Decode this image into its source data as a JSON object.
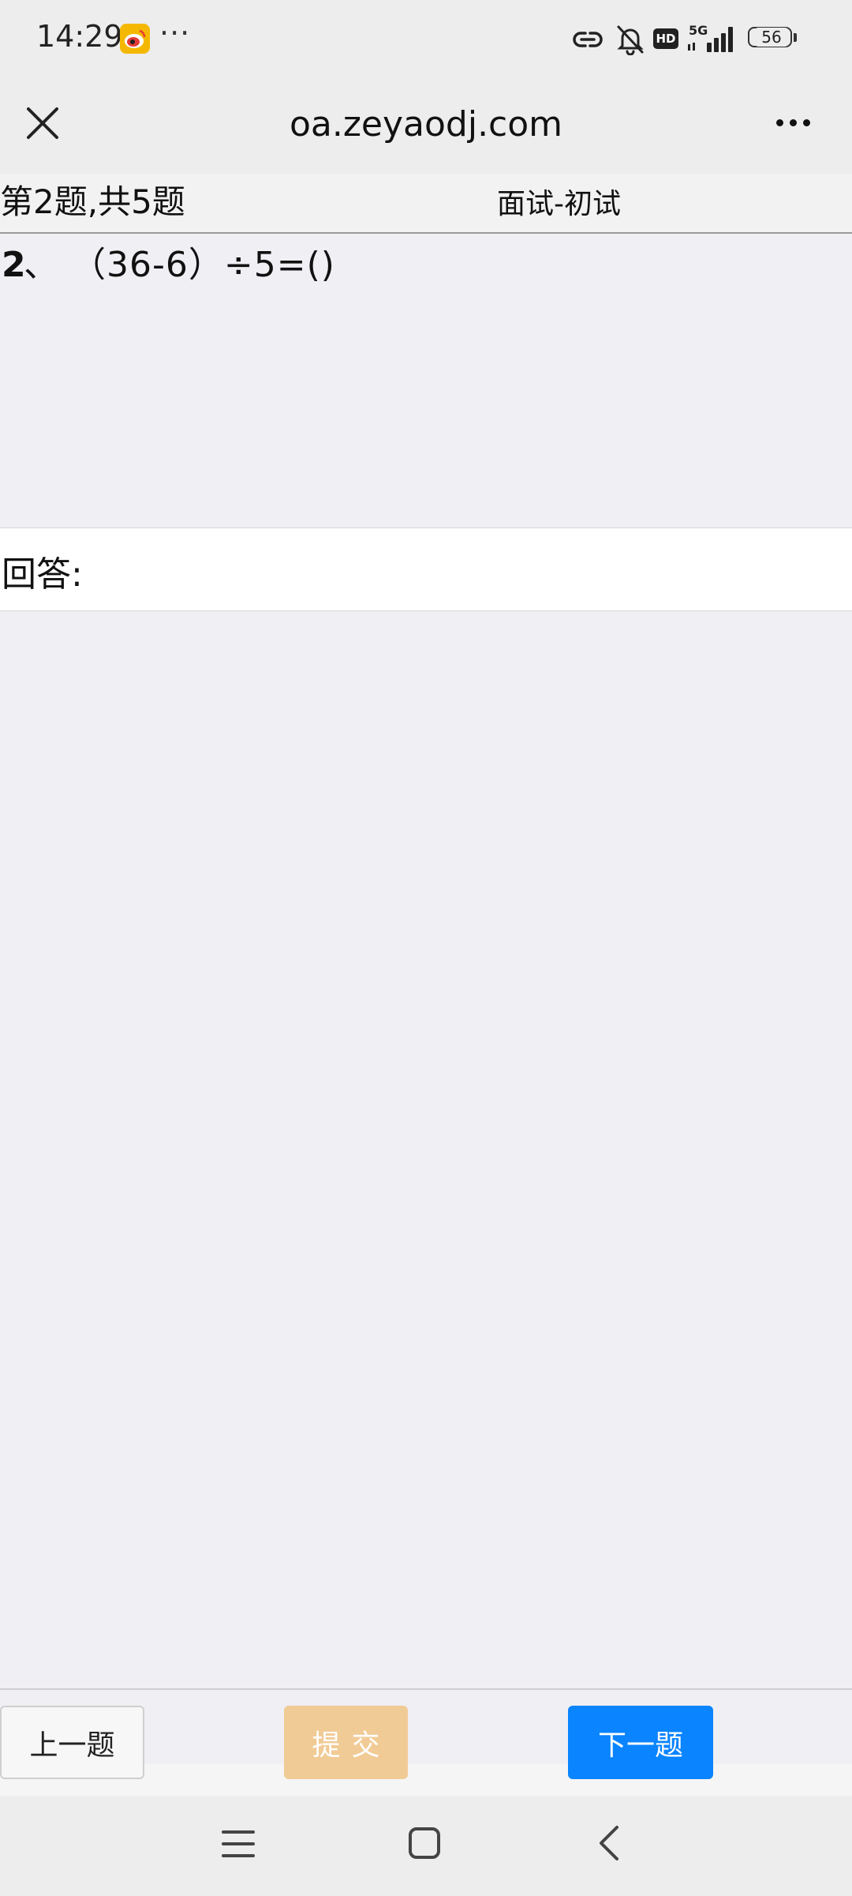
{
  "status_bar": {
    "time": "14:29",
    "more": "···",
    "network": "5G",
    "hd": "HD",
    "battery_level": "56",
    "icons": [
      "weibo-icon",
      "link-icon",
      "bell-muted-icon",
      "signal-icon",
      "battery-icon"
    ]
  },
  "browser": {
    "url_title": "oa.zeyaodj.com",
    "close_icon": "close-icon",
    "menu_icon": "more-icon"
  },
  "question": {
    "progress": "第2题,共5题",
    "exam_title": "面试-初试",
    "number": "2",
    "separator": "、",
    "text": "（36-6）÷5=()"
  },
  "answer": {
    "label": "回答:"
  },
  "footer": {
    "prev_label": "上一题",
    "submit_label": "提交",
    "next_label": "下一题"
  },
  "colors": {
    "submit_bg": "#f1cb96",
    "next_bg": "#0a84ff",
    "page_bg": "#efeff4"
  },
  "nav": {
    "icons": [
      "recent-apps-icon",
      "home-icon",
      "back-icon"
    ]
  }
}
